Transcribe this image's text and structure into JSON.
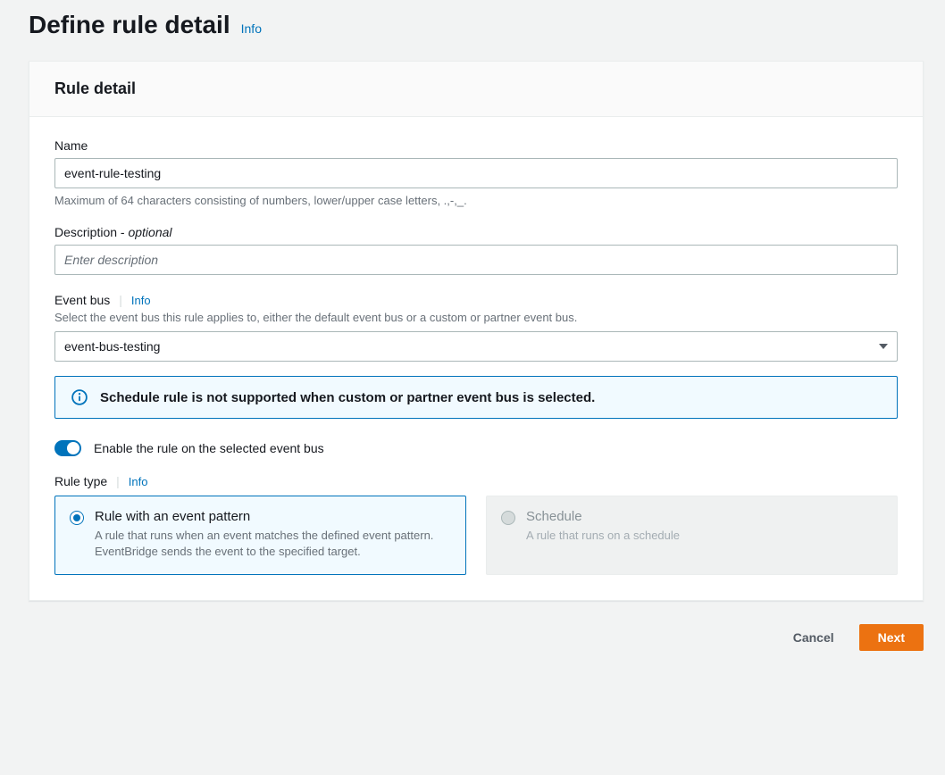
{
  "page": {
    "title": "Define rule detail",
    "info_label": "Info"
  },
  "panel": {
    "title": "Rule detail"
  },
  "name_field": {
    "label": "Name",
    "value": "event-rule-testing",
    "hint": "Maximum of 64 characters consisting of numbers, lower/upper case letters, .,-,_."
  },
  "description_field": {
    "label": "Description - ",
    "optional_text": "optional",
    "placeholder": "Enter description",
    "value": ""
  },
  "event_bus_field": {
    "label": "Event bus",
    "info_label": "Info",
    "hint": "Select the event bus this rule applies to, either the default event bus or a custom or partner event bus.",
    "selected": "event-bus-testing"
  },
  "alert": {
    "message": "Schedule rule is not supported when custom or partner event bus is selected."
  },
  "enable_toggle": {
    "label": "Enable the rule on the selected event bus",
    "on": true
  },
  "rule_type": {
    "label": "Rule type",
    "info_label": "Info",
    "options": [
      {
        "title": "Rule with an event pattern",
        "description": "A rule that runs when an event matches the defined event pattern. EventBridge sends the event to the specified target.",
        "selected": true,
        "disabled": false
      },
      {
        "title": "Schedule",
        "description": "A rule that runs on a schedule",
        "selected": false,
        "disabled": true
      }
    ]
  },
  "actions": {
    "cancel": "Cancel",
    "next": "Next"
  }
}
